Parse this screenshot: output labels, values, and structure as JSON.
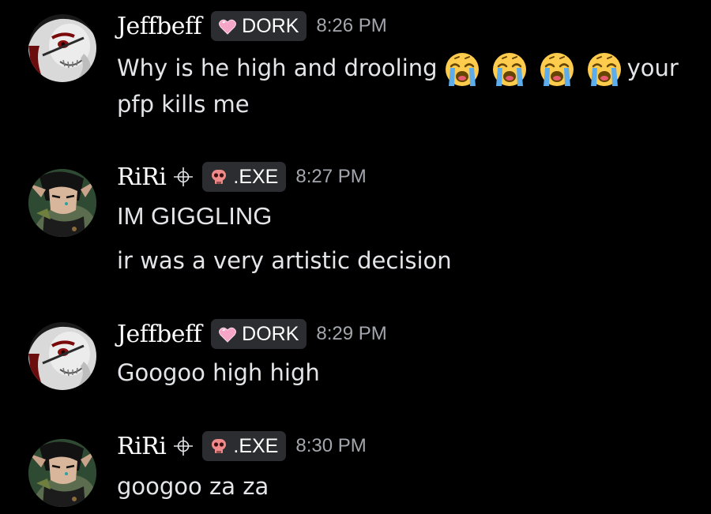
{
  "colors": {
    "background": "#000000",
    "username": "#ffffff",
    "text": "#e4e5e8",
    "timestamp": "#a3a6ad",
    "tag_bg": "#2b2d31",
    "dork_heart": "#f5a6c8",
    "exe_skull": "#f08a8a"
  },
  "messages": [
    {
      "author": "Jeffbeff",
      "tag_label": "DORK",
      "tag_icon": "pink-heart-icon",
      "time": "8:26 PM",
      "lines": [
        "Why is he high and drooling",
        "your",
        "pfp kills me"
      ],
      "emoji": [
        "loudly-crying-face-icon",
        "loudly-crying-face-icon",
        "loudly-crying-face-icon",
        "loudly-crying-face-icon"
      ]
    },
    {
      "author": "RiRi",
      "tag_label": ".EXE",
      "tag_icon": "skull-icon",
      "time": "8:27 PM",
      "lines": [
        "IM GIGGLING",
        "ir was a very artistic decision"
      ]
    },
    {
      "author": "Jeffbeff",
      "tag_label": "DORK",
      "tag_icon": "pink-heart-icon",
      "time": "8:29 PM",
      "lines": [
        "Googoo high high"
      ]
    },
    {
      "author": "RiRi",
      "tag_label": ".EXE",
      "tag_icon": "skull-icon",
      "time": "8:30 PM",
      "lines": [
        "googoo za za"
      ]
    }
  ]
}
